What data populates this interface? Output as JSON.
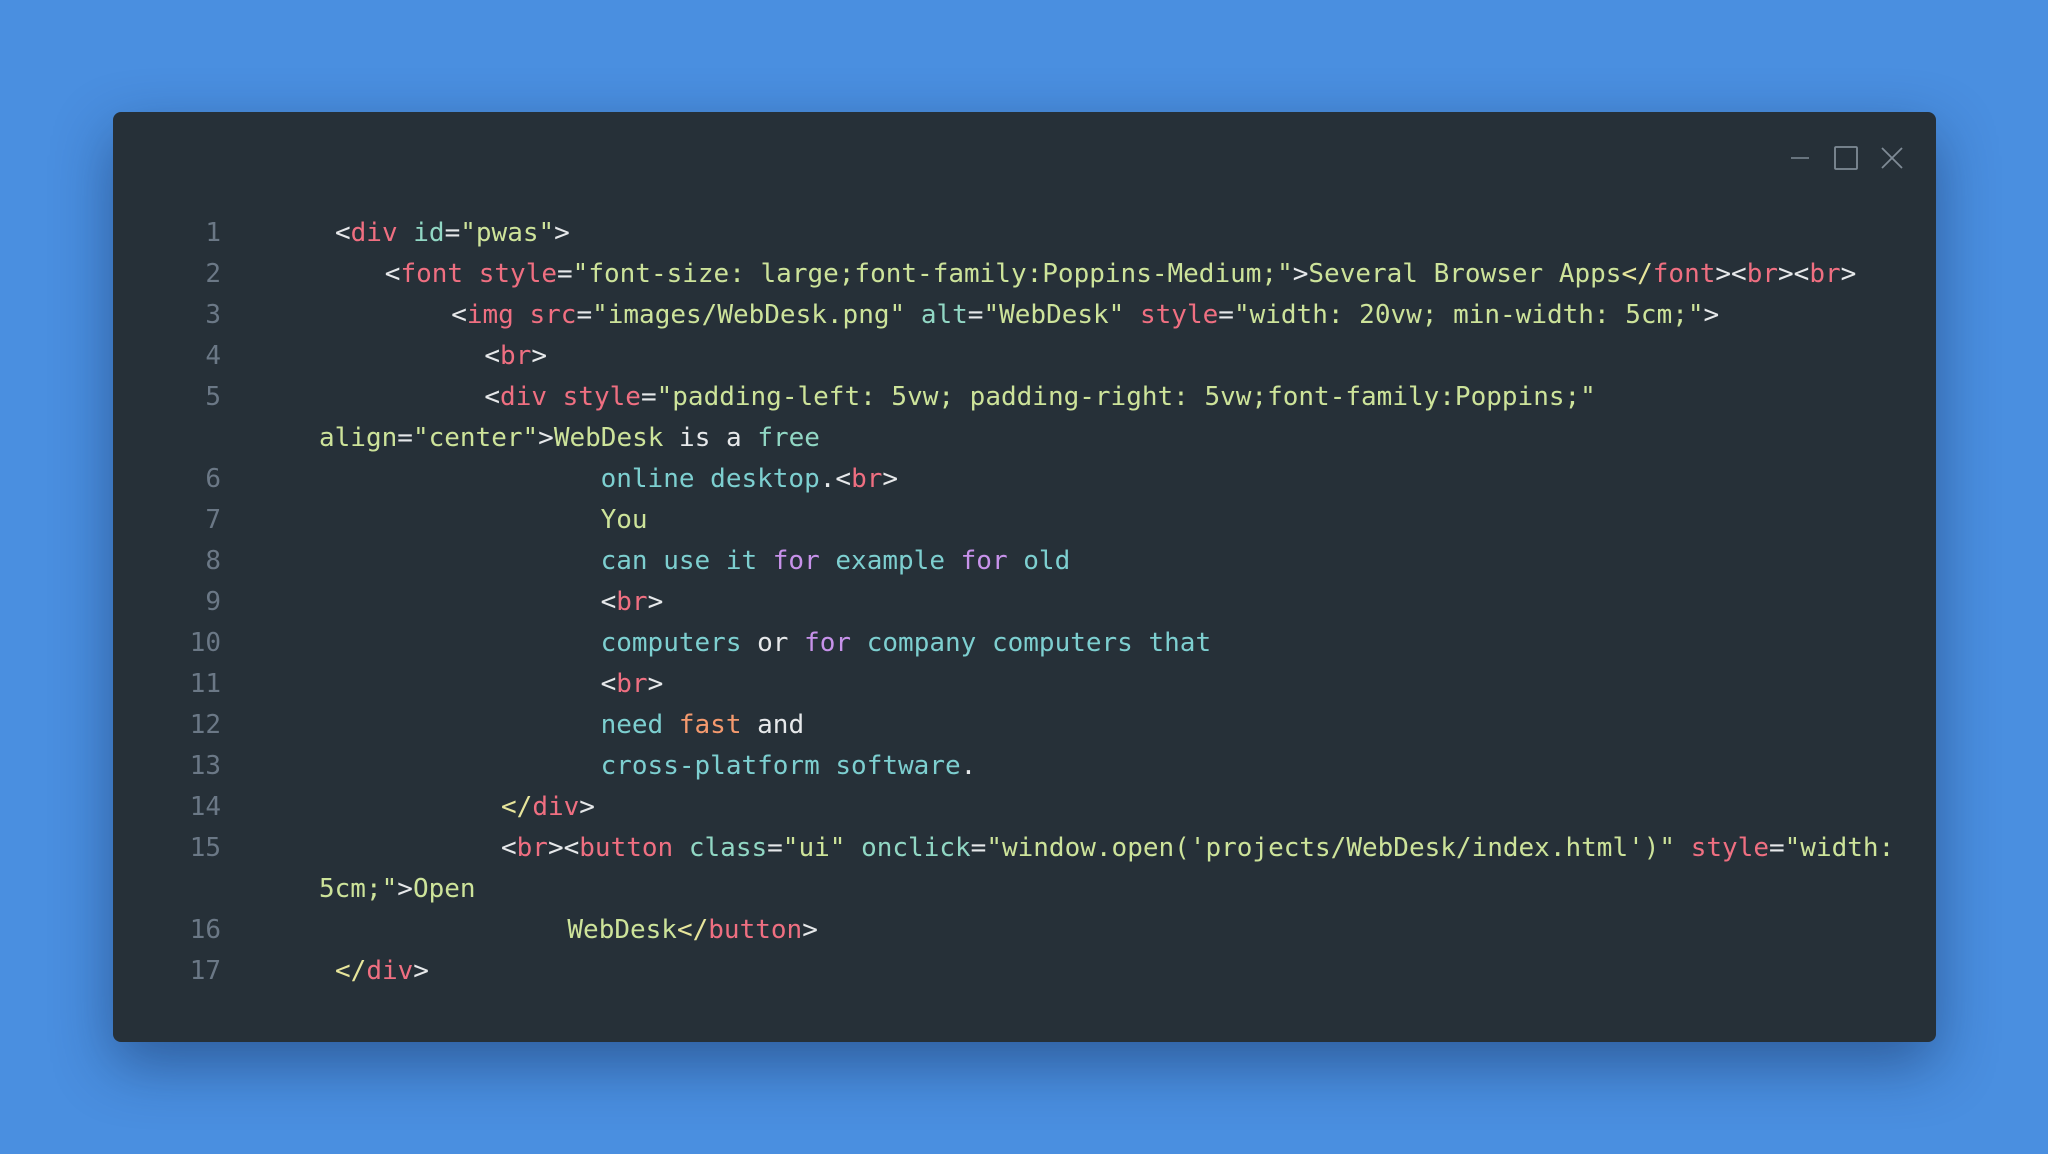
{
  "window": {
    "controls": {
      "minimize": "minimize-icon",
      "maximize": "maximize-icon",
      "close": "close-icon"
    }
  },
  "colors": {
    "background": "#4a8fe0",
    "editor": "#263038",
    "tag": "#ef6f81",
    "attribute": "#91d7c4",
    "string": "#cde39a",
    "text": "#e6e8ea",
    "keyword": "#c792ea",
    "line_number": "#6b7886"
  },
  "code": {
    "lines": [
      {
        "number": "1",
        "indent": 0,
        "wrapped": false,
        "tokens": [
          {
            "text": "<",
            "cls": "w"
          },
          {
            "text": "div",
            "cls": "t"
          },
          {
            "text": " ",
            "cls": "w"
          },
          {
            "text": "id",
            "cls": "a"
          },
          {
            "text": "=",
            "cls": "w"
          },
          {
            "text": "\"pwas\"",
            "cls": "s"
          },
          {
            "text": ">",
            "cls": "w"
          }
        ]
      },
      {
        "number": "2",
        "indent": 3,
        "wrapped": false,
        "tokens": [
          {
            "text": "<",
            "cls": "w"
          },
          {
            "text": "font",
            "cls": "t"
          },
          {
            "text": " ",
            "cls": "w"
          },
          {
            "text": "style",
            "cls": "t"
          },
          {
            "text": "=",
            "cls": "w"
          },
          {
            "text": "\"font-size: large;font-family:Poppins-Medium;\"",
            "cls": "s"
          },
          {
            "text": ">",
            "cls": "w"
          },
          {
            "text": "Several Browser Apps",
            "cls": "s"
          },
          {
            "text": "</",
            "cls": "y"
          },
          {
            "text": "font",
            "cls": "t"
          },
          {
            "text": "><",
            "cls": "w"
          },
          {
            "text": "br",
            "cls": "t"
          },
          {
            "text": "><",
            "cls": "w"
          },
          {
            "text": "br",
            "cls": "t"
          },
          {
            "text": ">",
            "cls": "w"
          }
        ]
      },
      {
        "number": "3",
        "indent": 7,
        "wrapped": false,
        "tokens": [
          {
            "text": "<",
            "cls": "w"
          },
          {
            "text": "img",
            "cls": "t"
          },
          {
            "text": " ",
            "cls": "w"
          },
          {
            "text": "src",
            "cls": "t"
          },
          {
            "text": "=",
            "cls": "w"
          },
          {
            "text": "\"images/WebDesk.png\"",
            "cls": "s"
          },
          {
            "text": " ",
            "cls": "w"
          },
          {
            "text": "alt",
            "cls": "a"
          },
          {
            "text": "=",
            "cls": "w"
          },
          {
            "text": "\"WebDesk\"",
            "cls": "s"
          },
          {
            "text": " ",
            "cls": "w"
          },
          {
            "text": "style",
            "cls": "t"
          },
          {
            "text": "=",
            "cls": "w"
          },
          {
            "text": "\"width: 20vw; min-width: 5cm;\"",
            "cls": "s"
          },
          {
            "text": ">",
            "cls": "w"
          }
        ]
      },
      {
        "number": "4",
        "indent": 9,
        "wrapped": false,
        "tokens": [
          {
            "text": "<",
            "cls": "w"
          },
          {
            "text": "br",
            "cls": "t"
          },
          {
            "text": ">",
            "cls": "w"
          }
        ]
      },
      {
        "number": "5",
        "indent": 9,
        "wrapped": false,
        "tokens": [
          {
            "text": "<",
            "cls": "w"
          },
          {
            "text": "div",
            "cls": "t"
          },
          {
            "text": " ",
            "cls": "w"
          },
          {
            "text": "style",
            "cls": "t"
          },
          {
            "text": "=",
            "cls": "w"
          },
          {
            "text": "\"padding-left: 5vw; padding-right: 5vw;font-family:Poppins;\"",
            "cls": "s"
          }
        ]
      },
      {
        "number": "",
        "indent": 0,
        "wrapped": true,
        "tokens": [
          {
            "text": "align",
            "cls": "s"
          },
          {
            "text": "=",
            "cls": "w"
          },
          {
            "text": "\"center\"",
            "cls": "s"
          },
          {
            "text": ">",
            "cls": "w"
          },
          {
            "text": "WebDesk",
            "cls": "s"
          },
          {
            "text": " is a ",
            "cls": "w"
          },
          {
            "text": "free",
            "cls": "a"
          }
        ]
      },
      {
        "number": "6",
        "indent": 16,
        "wrapped": false,
        "tokens": [
          {
            "text": "online desktop",
            "cls": "c"
          },
          {
            "text": ".",
            "cls": "w"
          },
          {
            "text": "<",
            "cls": "w"
          },
          {
            "text": "br",
            "cls": "t"
          },
          {
            "text": ">",
            "cls": "w"
          }
        ]
      },
      {
        "number": "7",
        "indent": 16,
        "wrapped": false,
        "tokens": [
          {
            "text": "You",
            "cls": "s"
          }
        ]
      },
      {
        "number": "8",
        "indent": 16,
        "wrapped": false,
        "tokens": [
          {
            "text": "can use it ",
            "cls": "c"
          },
          {
            "text": "for",
            "cls": "k"
          },
          {
            "text": " example ",
            "cls": "c"
          },
          {
            "text": "for",
            "cls": "k"
          },
          {
            "text": " old",
            "cls": "c"
          }
        ]
      },
      {
        "number": "9",
        "indent": 16,
        "wrapped": false,
        "tokens": [
          {
            "text": "<",
            "cls": "w"
          },
          {
            "text": "br",
            "cls": "t"
          },
          {
            "text": ">",
            "cls": "w"
          }
        ]
      },
      {
        "number": "10",
        "indent": 16,
        "wrapped": false,
        "tokens": [
          {
            "text": "computers ",
            "cls": "c"
          },
          {
            "text": "or ",
            "cls": "w"
          },
          {
            "text": "for",
            "cls": "k"
          },
          {
            "text": " company computers that",
            "cls": "c"
          }
        ]
      },
      {
        "number": "11",
        "indent": 16,
        "wrapped": false,
        "tokens": [
          {
            "text": "<",
            "cls": "w"
          },
          {
            "text": "br",
            "cls": "t"
          },
          {
            "text": ">",
            "cls": "w"
          }
        ]
      },
      {
        "number": "12",
        "indent": 16,
        "wrapped": false,
        "tokens": [
          {
            "text": "need ",
            "cls": "c"
          },
          {
            "text": "fast",
            "cls": "o"
          },
          {
            "text": " and",
            "cls": "w"
          }
        ]
      },
      {
        "number": "13",
        "indent": 16,
        "wrapped": false,
        "tokens": [
          {
            "text": "cross-platform software",
            "cls": "c"
          },
          {
            "text": ".",
            "cls": "w"
          }
        ]
      },
      {
        "number": "14",
        "indent": 10,
        "wrapped": false,
        "tokens": [
          {
            "text": "</",
            "cls": "y"
          },
          {
            "text": "div",
            "cls": "t"
          },
          {
            "text": ">",
            "cls": "w"
          }
        ]
      },
      {
        "number": "15",
        "indent": 10,
        "wrapped": false,
        "tokens": [
          {
            "text": "<",
            "cls": "w"
          },
          {
            "text": "br",
            "cls": "t"
          },
          {
            "text": "><",
            "cls": "w"
          },
          {
            "text": "button",
            "cls": "t"
          },
          {
            "text": " ",
            "cls": "w"
          },
          {
            "text": "class",
            "cls": "a"
          },
          {
            "text": "=",
            "cls": "w"
          },
          {
            "text": "\"ui\"",
            "cls": "s"
          },
          {
            "text": " ",
            "cls": "w"
          },
          {
            "text": "onclick",
            "cls": "a"
          },
          {
            "text": "=",
            "cls": "w"
          },
          {
            "text": "\"window.open('projects/WebDesk/index.html')\"",
            "cls": "s"
          },
          {
            "text": " ",
            "cls": "w"
          },
          {
            "text": "style",
            "cls": "t"
          },
          {
            "text": "=",
            "cls": "w"
          },
          {
            "text": "\"width:",
            "cls": "s"
          }
        ]
      },
      {
        "number": "",
        "indent": 0,
        "wrapped": true,
        "tokens": [
          {
            "text": "5cm;\"",
            "cls": "s"
          },
          {
            "text": ">",
            "cls": "w"
          },
          {
            "text": "Open",
            "cls": "s"
          }
        ]
      },
      {
        "number": "16",
        "indent": 14,
        "wrapped": false,
        "tokens": [
          {
            "text": "WebDesk",
            "cls": "s"
          },
          {
            "text": "</",
            "cls": "y"
          },
          {
            "text": "button",
            "cls": "t"
          },
          {
            "text": ">",
            "cls": "w"
          }
        ]
      },
      {
        "number": "17",
        "indent": 0,
        "wrapped": false,
        "tokens": [
          {
            "text": "</",
            "cls": "y"
          },
          {
            "text": "div",
            "cls": "t"
          },
          {
            "text": ">",
            "cls": "w"
          }
        ]
      }
    ]
  }
}
